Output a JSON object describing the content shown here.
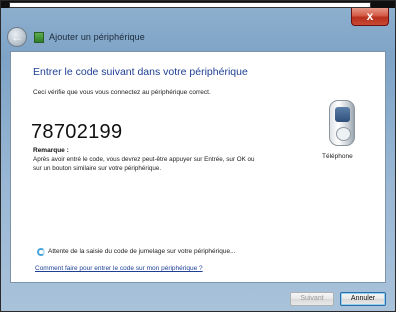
{
  "window": {
    "title": "Ajouter un périphérique",
    "close_label": "x",
    "back_label": "←"
  },
  "main": {
    "heading": "Entrer le code suivant dans votre périphérique",
    "description": "Ceci vérifie que vous vous connectez au périphérique correct.",
    "pairing_code": "78702199",
    "remark_label": "Remarque :",
    "remark_text": "Après avoir entré le code, vous devrez peut-être appuyer sur Entrée, sur OK ou sur un bouton similaire sur votre périphérique.",
    "device_label": "Téléphone",
    "waiting_text": "Attente de la saisie du code de jumelage sur votre périphérique...",
    "help_link": "Comment faire pour entrer le code sur mon périphérique ?"
  },
  "footer": {
    "next_label": "Suivant",
    "cancel_label": "Annuler"
  },
  "icons": {
    "back": "back-arrow-icon",
    "app": "bluetooth-device-icon",
    "device": "phone-icon",
    "waiting": "spinner-icon"
  },
  "colors": {
    "heading": "#1e3f94",
    "close_button": "#c74a33",
    "link": "#1e3f94"
  }
}
